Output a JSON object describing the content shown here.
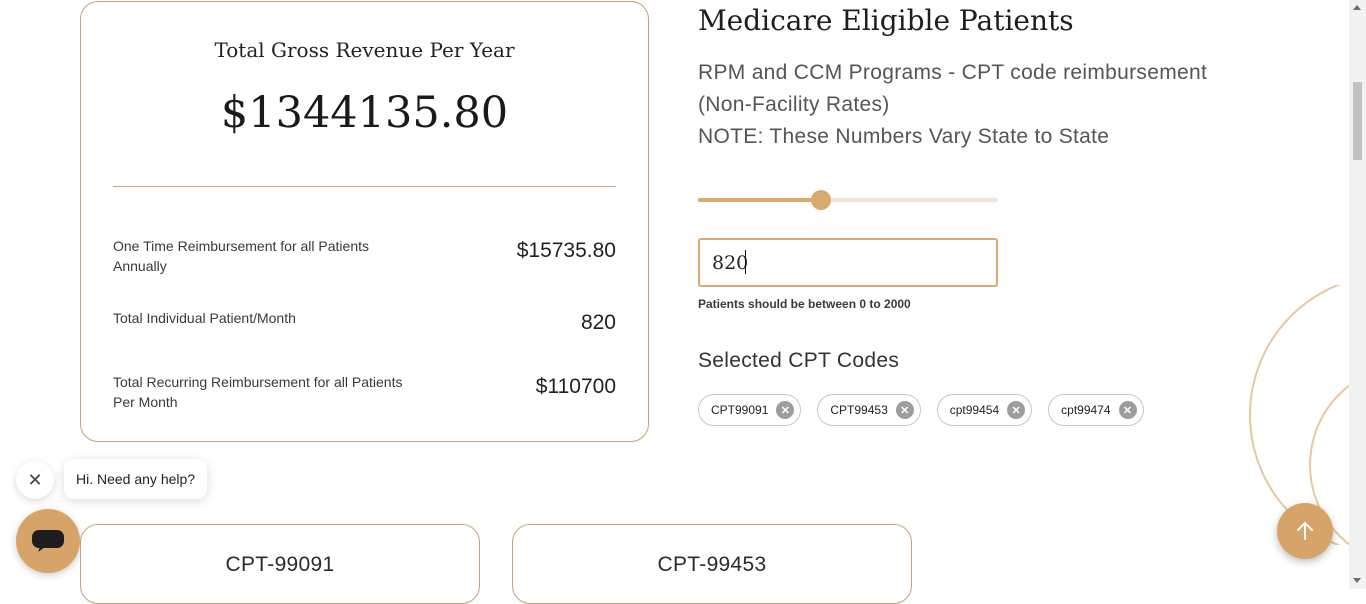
{
  "revenue_card": {
    "title": "Total Gross Revenue Per Year",
    "amount": "$1344135.80",
    "stats": [
      {
        "label": "One Time Reimbursement for all Patients Annually",
        "value": "$15735.80"
      },
      {
        "label": "Total Individual Patient/Month",
        "value": "820"
      },
      {
        "label": "Total Recurring Reimbursement for all Patients Per Month",
        "value": "$110700"
      }
    ]
  },
  "eligible": {
    "heading": "Medicare Eligible Patients",
    "sub_line1": "RPM and CCM Programs - CPT code reimbursement",
    "sub_line2": "(Non-Facility Rates)",
    "sub_line3": "NOTE: These Numbers Vary State to State",
    "slider": {
      "value": 820,
      "min": 0,
      "max": 2000
    },
    "input_value": "820",
    "help_text": "Patients should be between 0 to 2000"
  },
  "cpt": {
    "heading": "Selected CPT Codes",
    "chips": [
      "CPT99091",
      "CPT99453",
      "cpt99454",
      "cpt99474"
    ]
  },
  "chat": {
    "bubble_text": "Hi. Need any help?"
  },
  "cards": [
    {
      "title": "CPT-99091"
    },
    {
      "title": "CPT-99453"
    }
  ],
  "colors": {
    "accent": "#d6a469",
    "border": "#c9a274"
  },
  "icons": {
    "close": "close-icon",
    "chat": "chat-icon",
    "chip_remove": "x-circle-icon",
    "scroll_top": "arrow-up-icon"
  }
}
